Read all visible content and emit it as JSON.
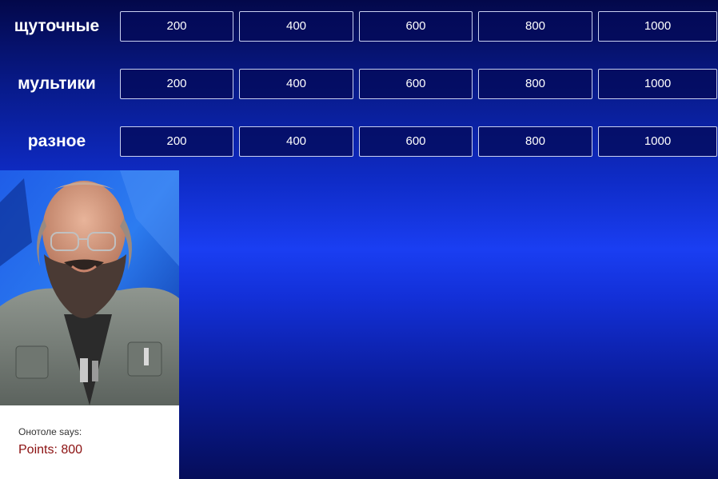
{
  "board": {
    "rows": [
      {
        "category": "щуточные",
        "values": [
          "200",
          "400",
          "600",
          "800",
          "1000"
        ]
      },
      {
        "category": "мультики",
        "values": [
          "200",
          "400",
          "600",
          "800",
          "1000"
        ]
      },
      {
        "category": "разное",
        "values": [
          "200",
          "400",
          "600",
          "800",
          "1000"
        ]
      }
    ]
  },
  "host": {
    "photo_icon": "bearded-host-portrait",
    "says_label": "Онотоле says:",
    "points_text": "Points: 800"
  },
  "colors": {
    "background_top": "#03084a",
    "background_mid": "#1a3ef2",
    "cell_border": "#c8d0f0",
    "points_text": "#8b1010"
  }
}
